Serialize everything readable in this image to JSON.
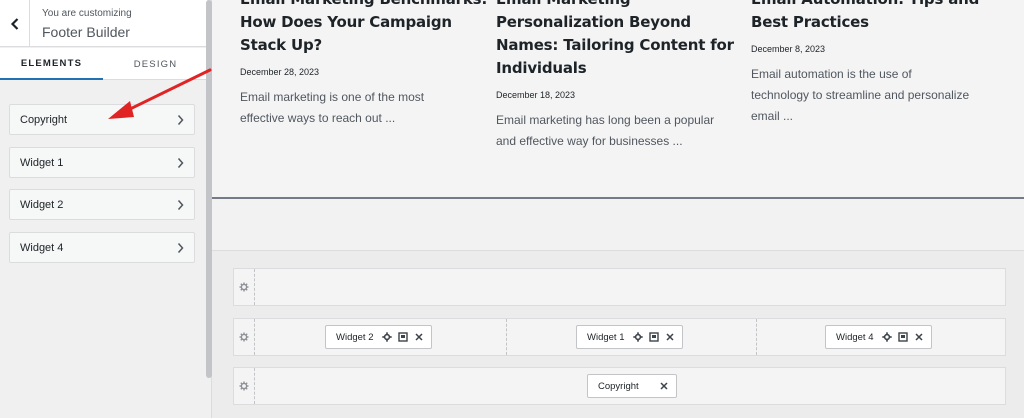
{
  "sidebar": {
    "subtitle": "You are customizing",
    "title": "Footer Builder",
    "tabs": [
      {
        "label": "ELEMENTS",
        "active": true
      },
      {
        "label": "DESIGN",
        "active": false
      }
    ],
    "items": [
      {
        "label": "Copyright"
      },
      {
        "label": "Widget 1"
      },
      {
        "label": "Widget 2"
      },
      {
        "label": "Widget 4"
      }
    ]
  },
  "posts": [
    {
      "title_lines": [
        "Email Marketing Benchmarks:",
        "How Does Your Campaign",
        "Stack Up?"
      ],
      "date": "December 28, 2023",
      "excerpt_lines": [
        "Email marketing is one of the most",
        "effective ways to reach out ..."
      ]
    },
    {
      "title_lines": [
        "Email Marketing",
        "Personalization Beyond",
        "Names: Tailoring Content for",
        "Individuals"
      ],
      "date": "December 18, 2023",
      "excerpt_lines": [
        "Email marketing has long been a popular",
        "and effective way for businesses ..."
      ]
    },
    {
      "title_lines": [
        "Email Automation: Tips and",
        "Best Practices"
      ],
      "date": "December 8, 2023",
      "excerpt_lines": [
        "Email automation is the use of",
        "technology to streamline and personalize",
        "email ..."
      ]
    }
  ],
  "footer_builder": {
    "middle_row": [
      {
        "label": "Widget 2"
      },
      {
        "label": "Widget 1"
      },
      {
        "label": "Widget 4"
      }
    ],
    "bottom_row": [
      {
        "label": "Copyright"
      }
    ]
  },
  "colors": {
    "accent": "#2271b1",
    "annotation_arrow": "#e02424"
  },
  "icons": {
    "back": "chevron-left-icon",
    "item_arrow": "chevron-right-icon",
    "row_settings": "gear-icon",
    "chip_settings": "gear-icon",
    "chip_design": "palette-icon",
    "chip_remove": "close-icon"
  }
}
